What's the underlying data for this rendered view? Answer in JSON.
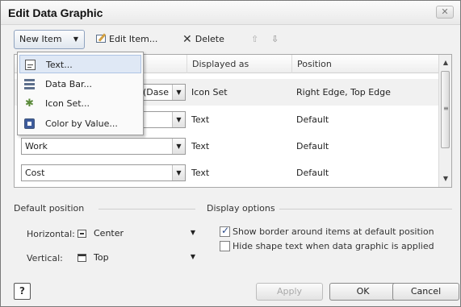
{
  "window": {
    "title": "Edit Data Graphic",
    "close_label": "✕"
  },
  "toolbar": {
    "new_item_label": "New Item",
    "edit_item_label": "Edit Item...",
    "delete_label": "Delete",
    "move_up_label": "⇧",
    "move_down_label": "⇩"
  },
  "new_item_menu": {
    "items": [
      {
        "label": "Text...",
        "icon": "text-icon"
      },
      {
        "label": "Data Bar...",
        "icon": "data-bar-icon"
      },
      {
        "label": "Icon Set...",
        "icon": "icon-set-icon"
      },
      {
        "label": "Color by Value...",
        "icon": "color-by-value-icon"
      }
    ]
  },
  "grid": {
    "columns": [
      "Displayed as",
      "Position"
    ],
    "rows": [
      {
        "field": "(Dase",
        "displayed_as": "Icon Set",
        "position": "Right Edge, Top Edge"
      },
      {
        "field": "",
        "displayed_as": "Text",
        "position": "Default"
      },
      {
        "field": "Work",
        "displayed_as": "Text",
        "position": "Default"
      },
      {
        "field": "Cost",
        "displayed_as": "Text",
        "position": "Default"
      }
    ]
  },
  "default_position": {
    "section_label": "Default position",
    "horizontal_label": "Horizontal:",
    "horizontal_value": "Center",
    "vertical_label": "Vertical:",
    "vertical_value": "Top"
  },
  "display_options": {
    "section_label": "Display options",
    "show_border_label": "Show border around items at default position",
    "show_border_checked": true,
    "hide_text_label": "Hide shape text when data graphic is applied",
    "hide_text_checked": false
  },
  "footer": {
    "help_label": "?",
    "apply_label": "Apply",
    "ok_label": "OK",
    "cancel_label": "Cancel"
  }
}
